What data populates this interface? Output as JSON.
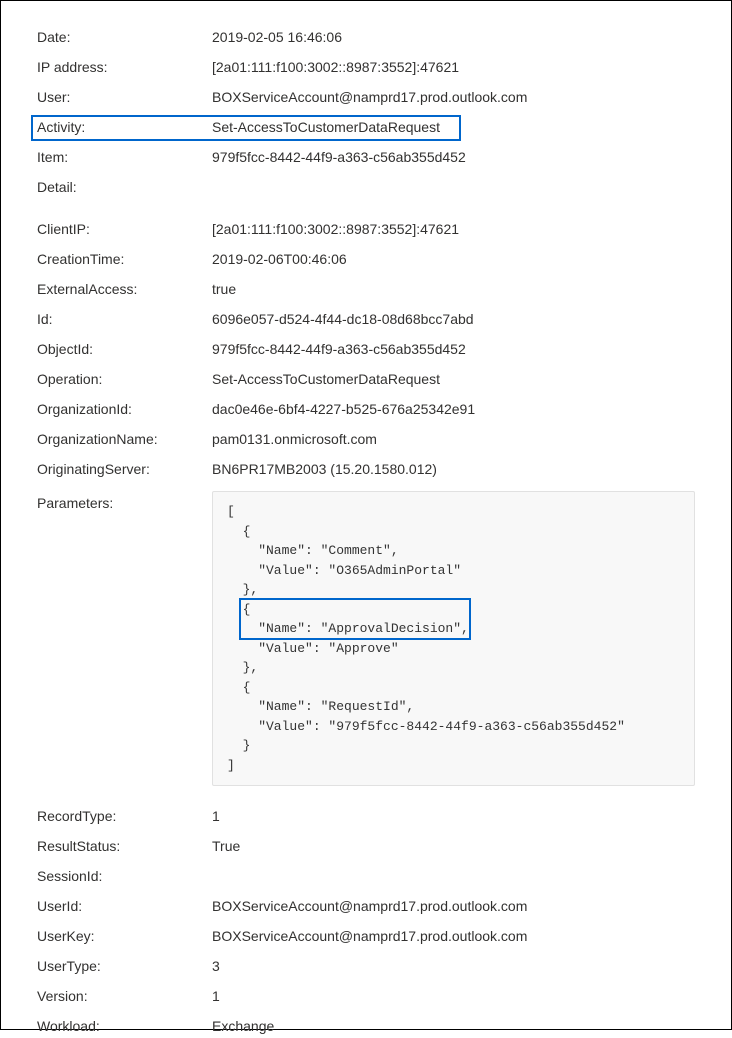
{
  "summary": {
    "date_label": "Date:",
    "date_value": "2019-02-05 16:46:06",
    "ip_label": "IP address:",
    "ip_value": "[2a01:111:f100:3002::8987:3552]:47621",
    "user_label": "User:",
    "user_value": "BOXServiceAccount@namprd17.prod.outlook.com",
    "activity_label": "Activity:",
    "activity_value": "Set-AccessToCustomerDataRequest",
    "item_label": "Item:",
    "item_value": "979f5fcc-8442-44f9-a363-c56ab355d452",
    "detail_label": "Detail:"
  },
  "detail": {
    "clientip_label": "ClientIP:",
    "clientip_value": "[2a01:111:f100:3002::8987:3552]:47621",
    "creationtime_label": "CreationTime:",
    "creationtime_value": "2019-02-06T00:46:06",
    "externalaccess_label": "ExternalAccess:",
    "externalaccess_value": "true",
    "id_label": "Id:",
    "id_value": "6096e057-d524-4f44-dc18-08d68bcc7abd",
    "objectid_label": "ObjectId:",
    "objectid_value": "979f5fcc-8442-44f9-a363-c56ab355d452",
    "operation_label": "Operation:",
    "operation_value": "Set-AccessToCustomerDataRequest",
    "organizationid_label": "OrganizationId:",
    "organizationid_value": "dac0e46e-6bf4-4227-b525-676a25342e91",
    "organizationname_label": "OrganizationName:",
    "organizationname_value": "pam0131.onmicrosoft.com",
    "originatingserver_label": "OriginatingServer:",
    "originatingserver_value": "BN6PR17MB2003 (15.20.1580.012)",
    "parameters_label": "Parameters:",
    "parameters_value": "[\n  {\n    \"Name\": \"Comment\",\n    \"Value\": \"O365AdminPortal\"\n  },\n  {\n    \"Name\": \"ApprovalDecision\",\n    \"Value\": \"Approve\"\n  },\n  {\n    \"Name\": \"RequestId\",\n    \"Value\": \"979f5fcc-8442-44f9-a363-c56ab355d452\"\n  }\n]",
    "recordtype_label": "RecordType:",
    "recordtype_value": "1",
    "resultstatus_label": "ResultStatus:",
    "resultstatus_value": "True",
    "sessionid_label": "SessionId:",
    "sessionid_value": "",
    "userid_label": "UserId:",
    "userid_value": "BOXServiceAccount@namprd17.prod.outlook.com",
    "userkey_label": "UserKey:",
    "userkey_value": "BOXServiceAccount@namprd17.prod.outlook.com",
    "usertype_label": "UserType:",
    "usertype_value": "3",
    "version_label": "Version:",
    "version_value": "1",
    "workload_label": "Workload:",
    "workload_value": "Exchange"
  }
}
